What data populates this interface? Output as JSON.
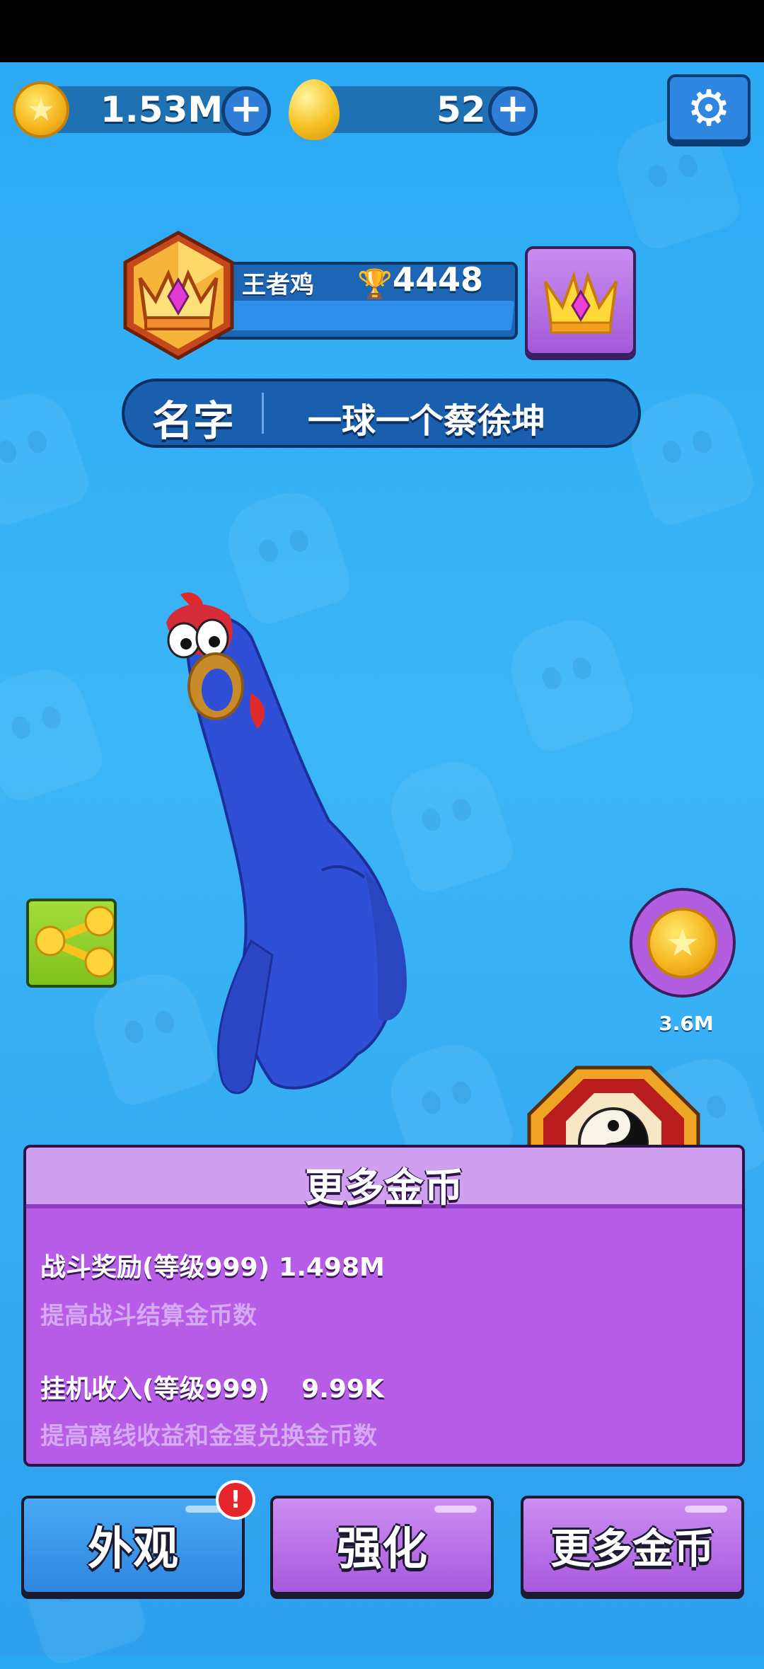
{
  "currency": {
    "coins_value": "1.53M",
    "eggs_value": "52",
    "add_label": "+"
  },
  "settings_icon": "gear-icon",
  "rank": {
    "title": "王者鸡",
    "trophy_icon": "trophy-icon",
    "trophies": "4448",
    "progress": 0.0
  },
  "profile": {
    "name_label": "名字",
    "name_value": "一球一个蔡徐坤"
  },
  "coin_timer": {
    "value": "3.6M"
  },
  "panel": {
    "title": "更多金币",
    "stats": [
      {
        "label": "战斗奖励(等级999)",
        "value": "1.498M",
        "description": "提高战斗结算金币数"
      },
      {
        "label": "挂机收入(等级999)",
        "value": "9.99K",
        "description": "提高离线收益和金蛋兑换金币数"
      }
    ]
  },
  "tabs": [
    {
      "label": "外观",
      "color": "#2f93ea",
      "alert": "!"
    },
    {
      "label": "强化",
      "color": "#b868e8"
    },
    {
      "label": "更多金币",
      "color": "#b868e8"
    }
  ],
  "colors": {
    "background": "#2aa8f4",
    "chicken": "#2f4fd6",
    "panel": "#b65ce6"
  }
}
